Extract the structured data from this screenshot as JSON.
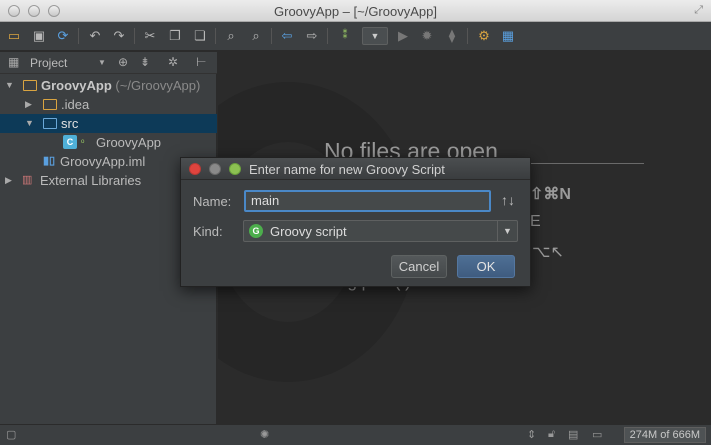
{
  "window": {
    "title": "GroovyApp – [~/GroovyApp]"
  },
  "project_panel": {
    "header_label": "Project",
    "tree": [
      {
        "label": "GroovyApp",
        "detail": "(~/GroovyApp)"
      },
      {
        "label": ".idea"
      },
      {
        "label": "src"
      },
      {
        "label": "GroovyApp"
      },
      {
        "label": "GroovyApp.iml"
      },
      {
        "label": "External Libraries"
      }
    ]
  },
  "editor": {
    "empty_title": "No files are open",
    "hint_shortcut_1": "⇧⌘N",
    "hint_shortcut_2": "E",
    "hint_shortcut_3": "⌥↖",
    "hint_drop": "ag    pen    (        )    om Finder"
  },
  "dialog": {
    "title": "Enter name for new Groovy Script",
    "name_label": "Name:",
    "name_value": "main",
    "kind_label": "Kind:",
    "kind_value": "Groovy script",
    "kind_icon_letter": "G",
    "cancel_label": "Cancel",
    "ok_label": "OK"
  },
  "statusbar": {
    "memory": "274M of 666M"
  },
  "colors": {
    "selection": "#0d3a58",
    "focus_border": "#4a88c7",
    "ok_button": "#3f5c80",
    "groovy_icon": "#4cae4c"
  }
}
